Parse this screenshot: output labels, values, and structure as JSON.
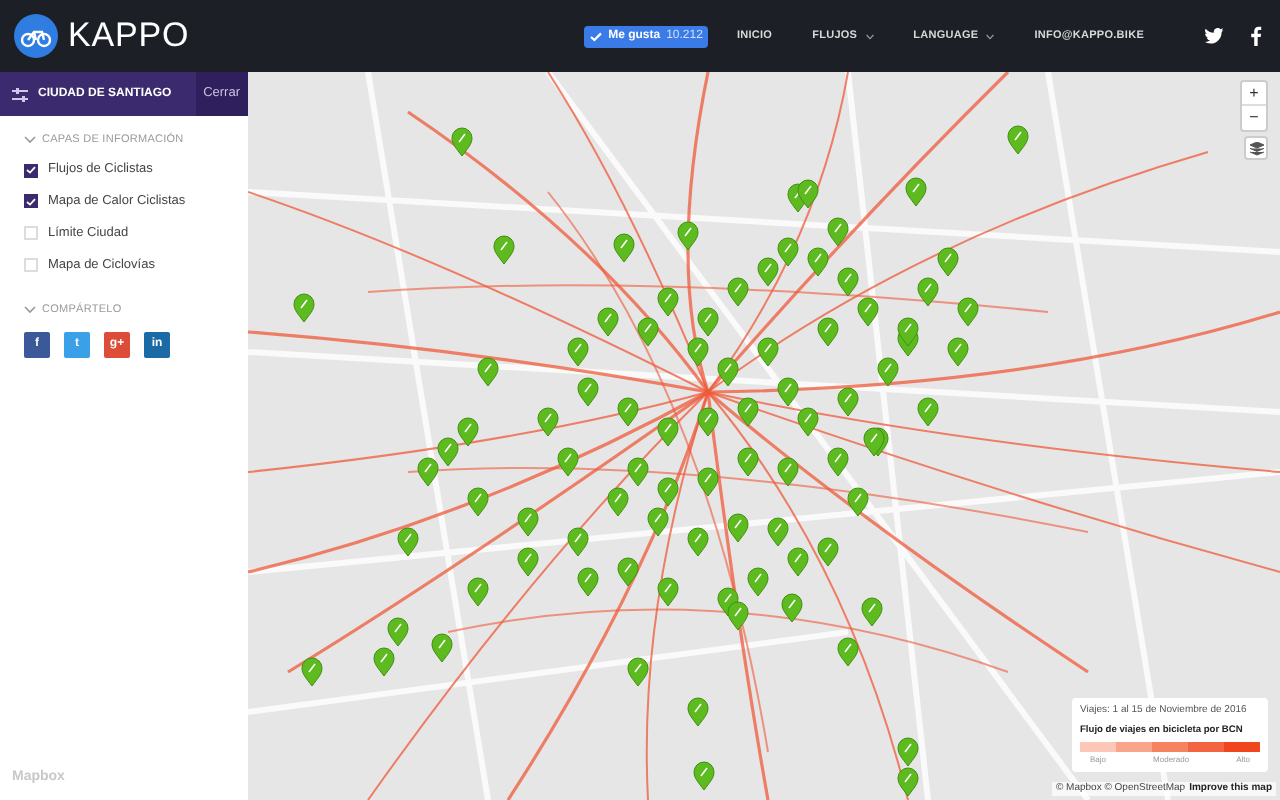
{
  "header": {
    "logo_text": "KAPPO",
    "like_button": {
      "label": "Me gusta",
      "count": "10.212"
    },
    "nav": [
      {
        "label": "INICIO",
        "dropdown": false
      },
      {
        "label": "FLUJOS",
        "dropdown": true
      },
      {
        "label": "LANGUAGE",
        "dropdown": true
      },
      {
        "label": "INFO@KAPPO.BIKE",
        "dropdown": false
      }
    ]
  },
  "sidebar": {
    "title": "CIUDAD DE SANTIAGO",
    "close_button": "Cerrar",
    "layers_heading": "CAPAS DE INFORMACIÓN",
    "layers": [
      {
        "label": "Flujos de Ciclistas",
        "checked": true
      },
      {
        "label": "Mapa de Calor Ciclistas",
        "checked": true
      },
      {
        "label": "Límite Ciudad",
        "checked": false
      },
      {
        "label": "Mapa de Ciclovías",
        "checked": false
      }
    ],
    "share_heading": "COMPÁRTELO",
    "share_buttons": [
      {
        "label": "f",
        "color": "#3b5998"
      },
      {
        "label": "t",
        "color": "#3aa0e8"
      },
      {
        "label": "g+",
        "color": "#dd4b39"
      },
      {
        "label": "in",
        "color": "#1a6aa6"
      }
    ]
  },
  "map": {
    "zoom_in": "+",
    "zoom_out": "−",
    "watermark": "Mapbox",
    "legend": {
      "period": "Viajes: 1 al 15 de Noviembre de 2016",
      "title": "Flujo de viajes en bicicleta por BCN",
      "scale_labels": [
        "Bajo",
        "Moderado",
        "Alto"
      ]
    },
    "attribution": {
      "text": "© Mapbox © OpenStreetMap",
      "link": "Improve this map"
    }
  }
}
